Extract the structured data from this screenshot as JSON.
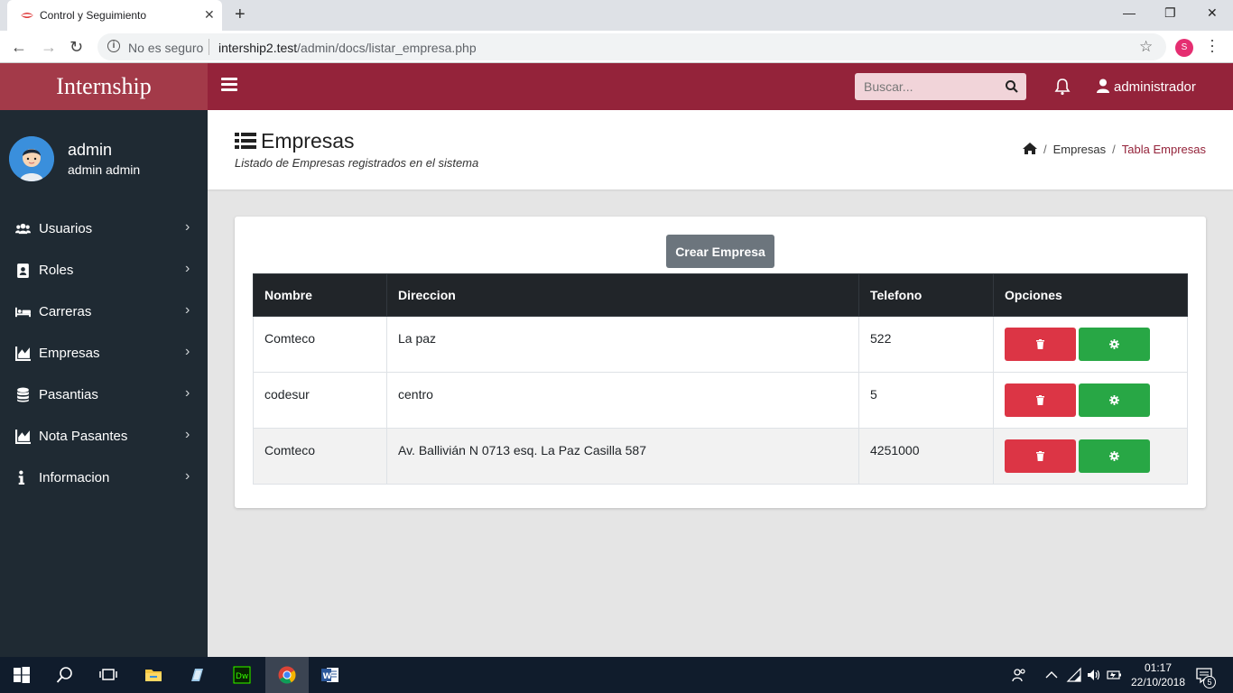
{
  "browser": {
    "tab_title": "Control y Seguimiento",
    "security_label": "No es seguro",
    "url_host": "intership2.test",
    "url_path": "/admin/docs/listar_empresa.php",
    "profile_initial": "S"
  },
  "app": {
    "brand": "Internship",
    "search_placeholder": "Buscar...",
    "user_menu_label": "administrador"
  },
  "sidebar": {
    "user_name": "admin",
    "user_full": "admin admin",
    "items": [
      {
        "label": "Usuarios",
        "icon": "users-icon"
      },
      {
        "label": "Roles",
        "icon": "id-card-icon"
      },
      {
        "label": "Carreras",
        "icon": "bed-icon"
      },
      {
        "label": "Empresas",
        "icon": "chart-icon"
      },
      {
        "label": "Pasantias",
        "icon": "database-icon"
      },
      {
        "label": "Nota Pasantes",
        "icon": "chart-icon"
      },
      {
        "label": "Informacion",
        "icon": "info-icon"
      }
    ]
  },
  "page": {
    "title": "Empresas",
    "subtitle": "Listado de Empresas registrados en el sistema",
    "breadcrumb": [
      "Empresas",
      "Tabla Empresas"
    ]
  },
  "table": {
    "create_button": "Crear Empresa",
    "headers": [
      "Nombre",
      "Direccion",
      "Telefono",
      "Opciones"
    ],
    "rows": [
      {
        "nombre": "Comteco",
        "direccion": "La paz",
        "telefono": "522"
      },
      {
        "nombre": "codesur",
        "direccion": "centro",
        "telefono": "5"
      },
      {
        "nombre": "Comteco",
        "direccion": "Av. Ballivián N 0713 esq. La Paz Casilla 587",
        "telefono": "4251000"
      }
    ]
  },
  "taskbar": {
    "time": "01:17",
    "date": "22/10/2018",
    "notification_count": "5"
  },
  "colors": {
    "brand": "#a33a49",
    "topbar": "#94233a",
    "sidebar": "#1f2a33",
    "danger": "#dc3545",
    "success": "#28a745"
  }
}
